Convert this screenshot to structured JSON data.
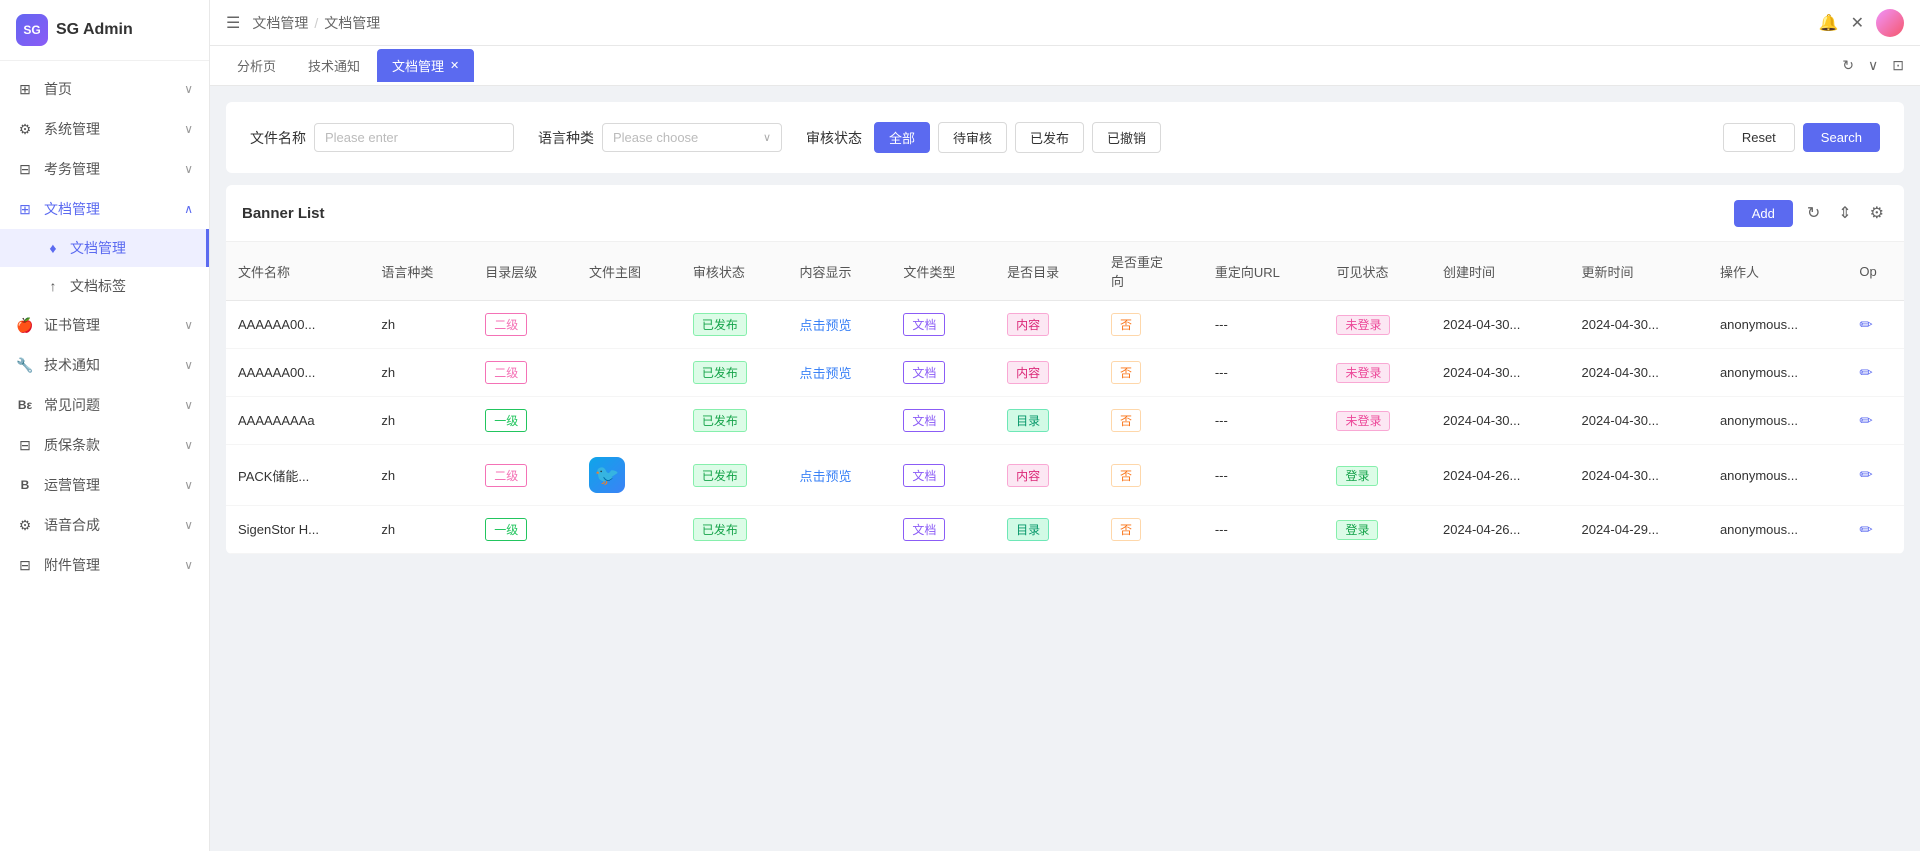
{
  "app": {
    "name": "SG Admin"
  },
  "sidebar": {
    "logo": "SG",
    "items": [
      {
        "id": "home",
        "icon": "⊞",
        "label": "首页",
        "hasChevron": true
      },
      {
        "id": "system",
        "icon": "⚙",
        "label": "系统管理",
        "hasChevron": true
      },
      {
        "id": "exam",
        "icon": "⊟",
        "label": "考务管理",
        "hasChevron": true
      },
      {
        "id": "docs",
        "icon": "⊞",
        "label": "文档管理",
        "hasChevron": true,
        "active": true,
        "expanded": true
      },
      {
        "id": "docs-sub",
        "icon": "♦",
        "label": "文档管理",
        "isSub": true,
        "active": true
      },
      {
        "id": "docs-tag",
        "icon": "↑",
        "label": "文档标签",
        "isSub": true
      },
      {
        "id": "cert",
        "icon": "🍎",
        "label": "证书管理",
        "hasChevron": true
      },
      {
        "id": "tech",
        "icon": "🔧",
        "label": "技术通知",
        "hasChevron": true
      },
      {
        "id": "faq",
        "icon": "Be",
        "label": "常见问题",
        "hasChevron": true
      },
      {
        "id": "quality",
        "icon": "⊟",
        "label": "质保条款",
        "hasChevron": true
      },
      {
        "id": "ops",
        "icon": "B",
        "label": "运营管理",
        "hasChevron": true
      },
      {
        "id": "voice",
        "icon": "⚙",
        "label": "语音合成",
        "hasChevron": true
      },
      {
        "id": "attachment",
        "icon": "⊟",
        "label": "附件管理",
        "hasChevron": true
      }
    ]
  },
  "topbar": {
    "menu_icon": "☰",
    "breadcrumb": [
      "文档管理",
      "/",
      "文档管理"
    ],
    "icons": [
      "🔔",
      "✕"
    ]
  },
  "tabs": [
    {
      "id": "analysis",
      "label": "分析页",
      "closable": false
    },
    {
      "id": "tech-notice",
      "label": "技术通知",
      "closable": false
    },
    {
      "id": "doc-mgmt",
      "label": "文档管理",
      "closable": true,
      "active": true
    }
  ],
  "filter": {
    "filename_label": "文件名称",
    "filename_placeholder": "Please enter",
    "language_label": "语言种类",
    "language_placeholder": "Please choose",
    "status_label": "审核状态",
    "status_options": [
      {
        "id": "all",
        "label": "全部",
        "active": true
      },
      {
        "id": "pending",
        "label": "待审核"
      },
      {
        "id": "published",
        "label": "已发布"
      },
      {
        "id": "revoked",
        "label": "已撤销"
      }
    ],
    "reset_label": "Reset",
    "search_label": "Search"
  },
  "table": {
    "title": "Banner List",
    "add_label": "Add",
    "columns": [
      "文件名称",
      "语言种类",
      "目录层级",
      "文件主图",
      "审核状态",
      "内容显示",
      "文件类型",
      "是否目录",
      "是否重定向",
      "重定向URL",
      "可见状态",
      "创建时间",
      "更新时间",
      "操作人",
      "Op"
    ],
    "rows": [
      {
        "filename": "AAAAAA00...",
        "lang": "zh",
        "level": "二级",
        "level_color": "pink",
        "thumb": "",
        "status": "已发布",
        "preview": "点击预览",
        "filetype": "文档",
        "is_catalog": "内容",
        "is_redirect": "否",
        "redirect_url": "---",
        "visible": "未登录",
        "created": "2024-04-30...",
        "updated": "2024-04-30...",
        "operator": "anonymous..."
      },
      {
        "filename": "AAAAAA00...",
        "lang": "zh",
        "level": "二级",
        "level_color": "pink",
        "thumb": "",
        "status": "已发布",
        "preview": "点击预览",
        "filetype": "文档",
        "is_catalog": "内容",
        "is_redirect": "否",
        "redirect_url": "---",
        "visible": "未登录",
        "created": "2024-04-30...",
        "updated": "2024-04-30...",
        "operator": "anonymous..."
      },
      {
        "filename": "AAAAAAAAa",
        "lang": "zh",
        "level": "一级",
        "level_color": "green",
        "thumb": "",
        "status": "已发布",
        "preview": "",
        "filetype": "文档",
        "is_catalog": "目录",
        "is_redirect": "否",
        "redirect_url": "---",
        "visible": "未登录",
        "created": "2024-04-30...",
        "updated": "2024-04-30...",
        "operator": "anonymous..."
      },
      {
        "filename": "PACK储能...",
        "lang": "zh",
        "level": "二级",
        "level_color": "pink",
        "thumb": "app-icon",
        "status": "已发布",
        "preview": "点击预览",
        "filetype": "文档",
        "is_catalog": "内容",
        "is_redirect": "否",
        "redirect_url": "---",
        "visible": "登录",
        "created": "2024-04-26...",
        "updated": "2024-04-30...",
        "operator": "anonymous..."
      },
      {
        "filename": "SigenStor H...",
        "lang": "zh",
        "level": "一级",
        "level_color": "green",
        "thumb": "",
        "status": "已发布",
        "preview": "",
        "filetype": "文档",
        "is_catalog": "目录",
        "is_redirect": "否",
        "redirect_url": "---",
        "visible": "登录",
        "created": "2024-04-26...",
        "updated": "2024-04-29...",
        "operator": "anonymous..."
      }
    ]
  }
}
